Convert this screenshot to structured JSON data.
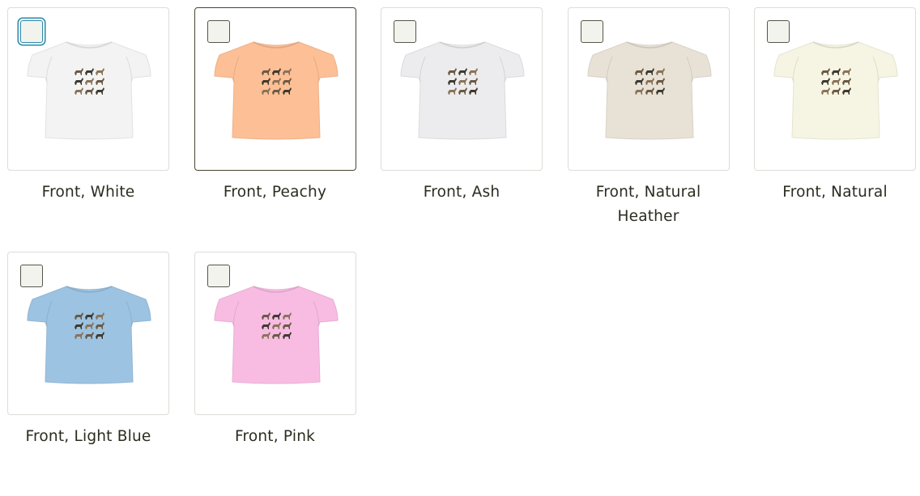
{
  "mockups": [
    {
      "label": "Front, White",
      "shirt_color": "#f3f3f3",
      "selected": false,
      "focused": true
    },
    {
      "label": "Front, Peachy",
      "shirt_color": "#fdbf95",
      "selected": true,
      "focused": false
    },
    {
      "label": "Front, Ash",
      "shirt_color": "#ececee",
      "selected": false,
      "focused": false
    },
    {
      "label": "Front, Natural Heather",
      "shirt_color": "#e8e2d6",
      "selected": false,
      "focused": false
    },
    {
      "label": "Front, Natural",
      "shirt_color": "#f6f5e3",
      "selected": false,
      "focused": false
    },
    {
      "label": "Front, Light Blue",
      "shirt_color": "#9dc3e2",
      "selected": false,
      "focused": false
    },
    {
      "label": "Front, Pink",
      "shirt_color": "#f8bce3",
      "selected": false,
      "focused": false
    }
  ],
  "colors": {
    "text": "#2b2b1f",
    "card_border": "#dcdcd8",
    "selected_border": "#4a4430",
    "focus_ring": "#2a89a8",
    "checkbox_fill": "#f3f3ee"
  },
  "icons": {
    "shirt": "t-shirt-mockup-icon",
    "design": "horse-print-design-icon"
  }
}
